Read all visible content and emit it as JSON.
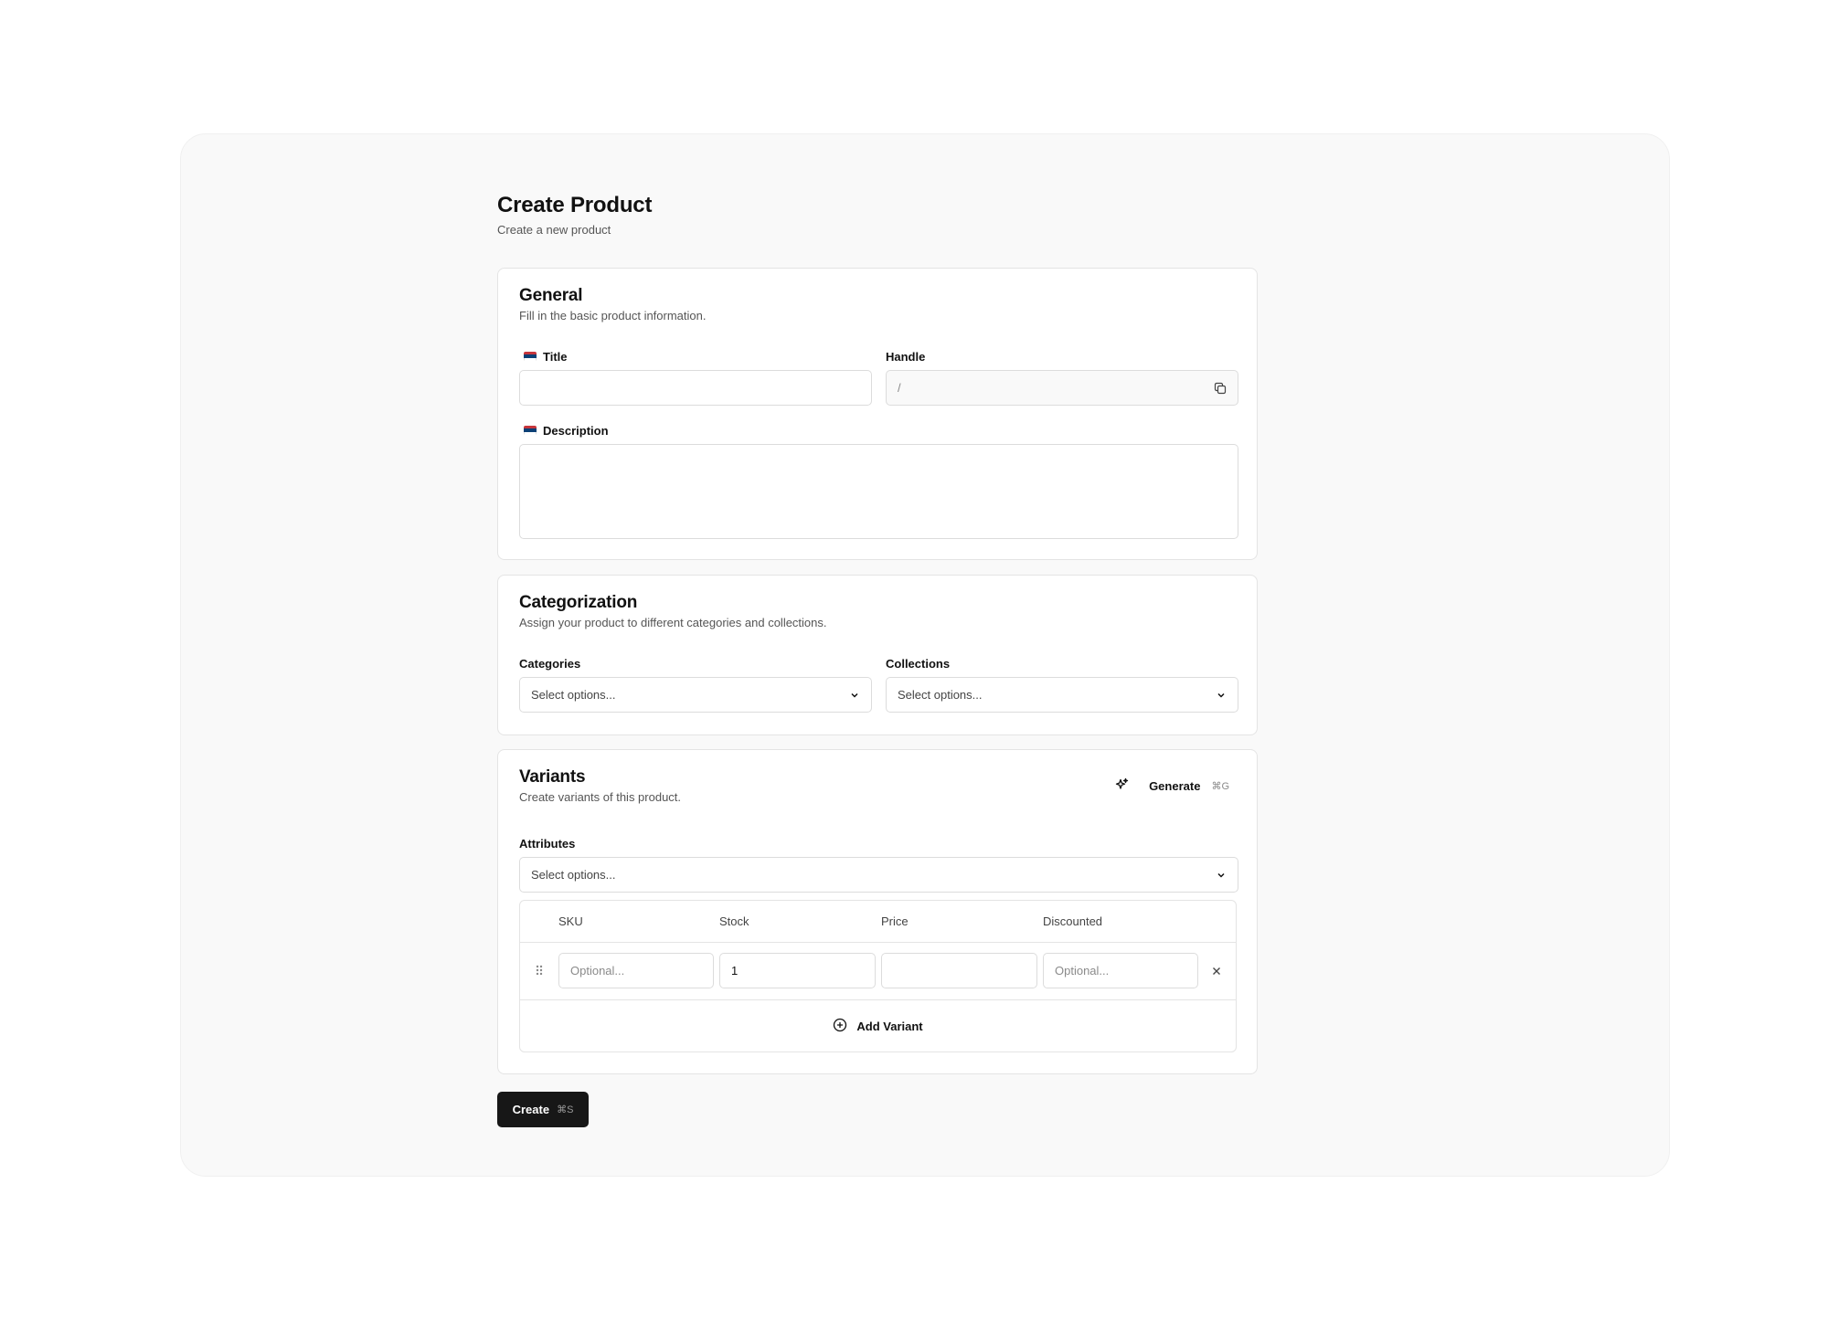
{
  "header": {
    "title": "Create Product",
    "subtitle": "Create a new product"
  },
  "general": {
    "title": "General",
    "description": "Fill in the basic product information.",
    "title_label": "Title",
    "title_value": "",
    "handle_label": "Handle",
    "handle_prefix": "/",
    "description_label": "Description",
    "description_value": ""
  },
  "categorization": {
    "title": "Categorization",
    "description": "Assign your product to different categories and collections.",
    "categories_label": "Categories",
    "categories_placeholder": "Select options...",
    "collections_label": "Collections",
    "collections_placeholder": "Select options..."
  },
  "variants": {
    "title": "Variants",
    "description": "Create variants of this product.",
    "generate_label": "Generate",
    "generate_shortcut": "⌘G",
    "attributes_label": "Attributes",
    "attributes_placeholder": "Select options...",
    "columns": [
      "SKU",
      "Stock",
      "Price",
      "Discounted"
    ],
    "rows": [
      {
        "sku": "",
        "sku_placeholder": "Optional...",
        "stock": "1",
        "price": "",
        "discounted": "",
        "discounted_placeholder": "Optional..."
      }
    ],
    "add_variant_label": "Add Variant"
  },
  "footer": {
    "create_label": "Create",
    "create_shortcut": "⌘S"
  },
  "icons": {
    "flag": "serbia-flag-icon",
    "copy": "copy-icon",
    "chevron": "chevron-down-icon",
    "sparkle": "sparkle-icon",
    "drag": "drag-handle-icon",
    "remove": "close-icon",
    "add": "plus-circle-icon"
  },
  "colors": {
    "frame_bg": "#f9f9f9",
    "card_border": "#e4e4e4",
    "primary_button": "#171717"
  }
}
